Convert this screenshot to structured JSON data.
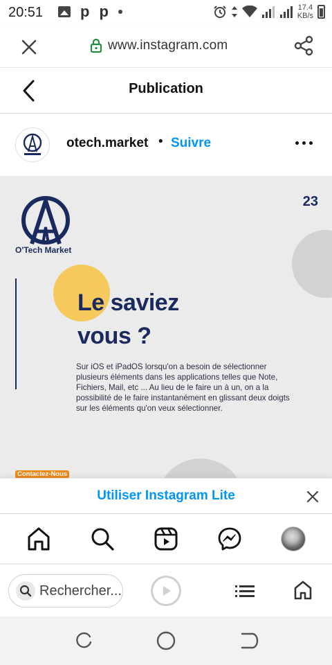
{
  "status_bar": {
    "time": "20:51",
    "notif_p1": "p",
    "notif_p2": "p",
    "speed_value": "17.4",
    "speed_unit": "KB/s",
    "icons": [
      "image-icon",
      "p-icon",
      "p-icon",
      "dot-icon",
      "alarm-icon",
      "data-arrows-icon",
      "wifi-icon",
      "signal-icon",
      "signal-icon",
      "battery-icon"
    ]
  },
  "browser": {
    "url": "www.instagram.com",
    "toolbar": {
      "search_placeholder": "Rechercher..."
    }
  },
  "header": {
    "title": "Publication"
  },
  "post": {
    "author": "otech.market",
    "separator": "•",
    "follow_label": "Suivre",
    "image": {
      "brand_name": "O'Tech Market",
      "number": "23",
      "headline_line1": "Le saviez",
      "headline_line2": "vous ?",
      "body": "Sur iOS et iPadOS lorsqu'on a besoin de sélectionner plusieurs éléments dans les applications telles que Note, Fichiers, Mail, etc ... Au lieu de le faire un à un, on a la possibilité de le faire instantanément en glissant deux doigts sur les éléments qu'on veux sélectionner.",
      "contact_label": "Contactez-Nous"
    }
  },
  "lite_banner": {
    "label": "Utiliser Instagram Lite"
  },
  "colors": {
    "brand_navy": "#1a2a5e",
    "link_blue": "#0095f6",
    "accent_yellow": "#f6c95c",
    "accent_orange": "#f0871a",
    "lock_green": "#1e8e3e"
  }
}
